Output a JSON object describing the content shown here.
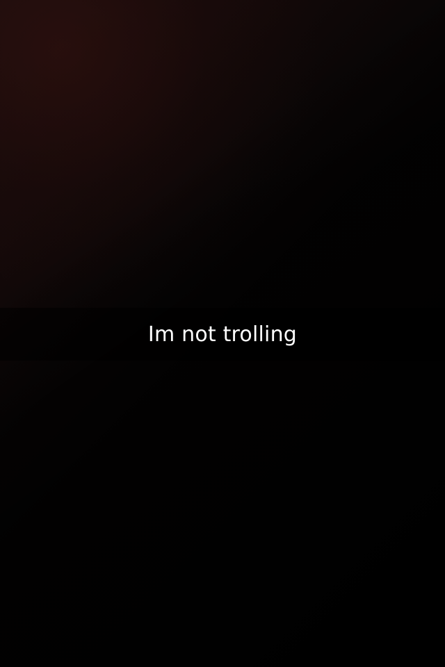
{
  "snap": {
    "caption": "Im not trolling"
  },
  "colors": {
    "background": "#000000",
    "caption_text": "#ffffff",
    "caption_bar": "rgba(0,0,0,0.55)"
  }
}
